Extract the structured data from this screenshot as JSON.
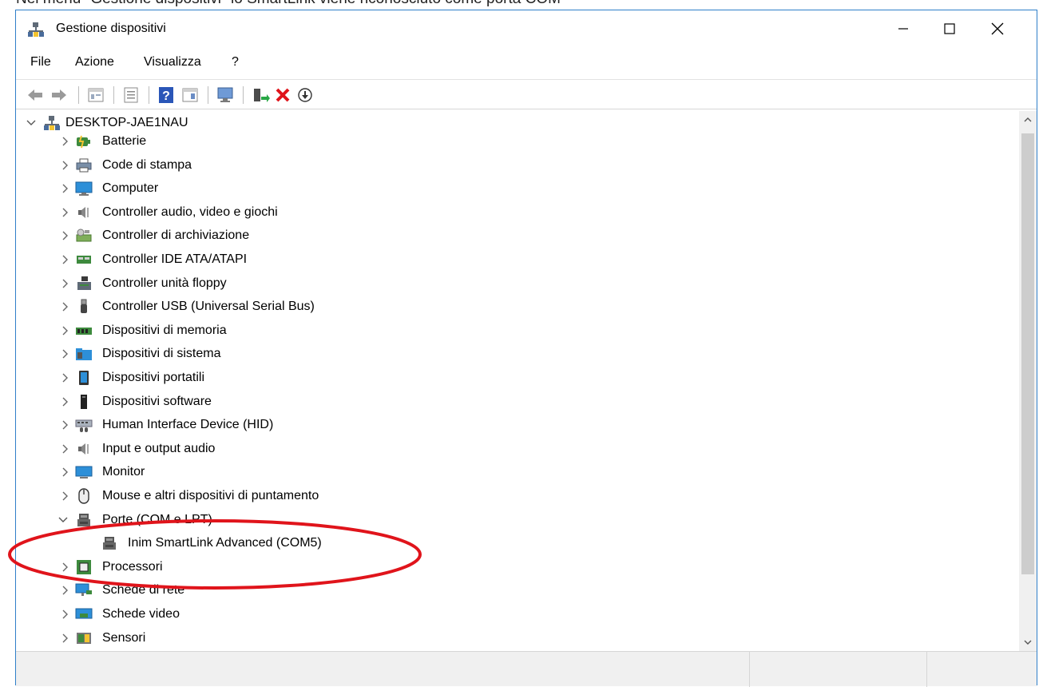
{
  "caption": "Nel menu \"Gestione dispositivi\" lo SmartLink viene riconosciuto come porta COM",
  "window": {
    "title": "Gestione dispositivi",
    "controls": {
      "minimize": "minimize-icon",
      "maximize": "maximize-icon",
      "close": "close-icon"
    }
  },
  "menu": {
    "file": "File",
    "azione": "Azione",
    "visualizza": "Visualizza",
    "help": "?"
  },
  "toolbar": [
    "back-arrow-icon",
    "forward-arrow-icon",
    "properties-view-icon",
    "list-view-icon",
    "help-icon",
    "details-pane-icon",
    "scan-hardware-icon",
    "update-driver-icon",
    "uninstall-icon",
    "disable-device-icon"
  ],
  "tree": {
    "root": "DESKTOP-JAE1NAU",
    "items": [
      {
        "label": "Batterie",
        "icon": "battery-icon"
      },
      {
        "label": "Code di stampa",
        "icon": "printer-icon"
      },
      {
        "label": "Computer",
        "icon": "computer-icon"
      },
      {
        "label": "Controller audio, video e giochi",
        "icon": "speaker-icon"
      },
      {
        "label": "Controller di archiviazione",
        "icon": "storage-icon"
      },
      {
        "label": "Controller IDE ATA/ATAPI",
        "icon": "ide-controller-icon"
      },
      {
        "label": "Controller unità floppy",
        "icon": "floppy-icon"
      },
      {
        "label": "Controller USB (Universal Serial Bus)",
        "icon": "usb-icon"
      },
      {
        "label": "Dispositivi di memoria",
        "icon": "memory-icon"
      },
      {
        "label": "Dispositivi di sistema",
        "icon": "system-folder-icon"
      },
      {
        "label": "Dispositivi portatili",
        "icon": "portable-device-icon"
      },
      {
        "label": "Dispositivi software",
        "icon": "software-device-icon"
      },
      {
        "label": "Human Interface Device (HID)",
        "icon": "hid-icon"
      },
      {
        "label": "Input e output audio",
        "icon": "speaker-icon"
      },
      {
        "label": "Monitor",
        "icon": "monitor-icon"
      },
      {
        "label": "Mouse e altri dispositivi di puntamento",
        "icon": "mouse-icon"
      },
      {
        "label": "Porte (COM e LPT)",
        "icon": "port-icon",
        "expanded": true
      },
      {
        "label": "Inim SmartLink Advanced (COM5)",
        "icon": "port-icon",
        "child": true
      },
      {
        "label": "Processori",
        "icon": "processor-icon"
      },
      {
        "label": "Schede di rete",
        "icon": "network-icon"
      },
      {
        "label": "Schede video",
        "icon": "display-adapter-icon"
      },
      {
        "label": "Sensori",
        "icon": "sensor-icon"
      }
    ]
  },
  "colors": {
    "window_border": "#2f7fc9",
    "highlight_ellipse": "#e0141b",
    "status_bar": "#f0f0f0"
  }
}
